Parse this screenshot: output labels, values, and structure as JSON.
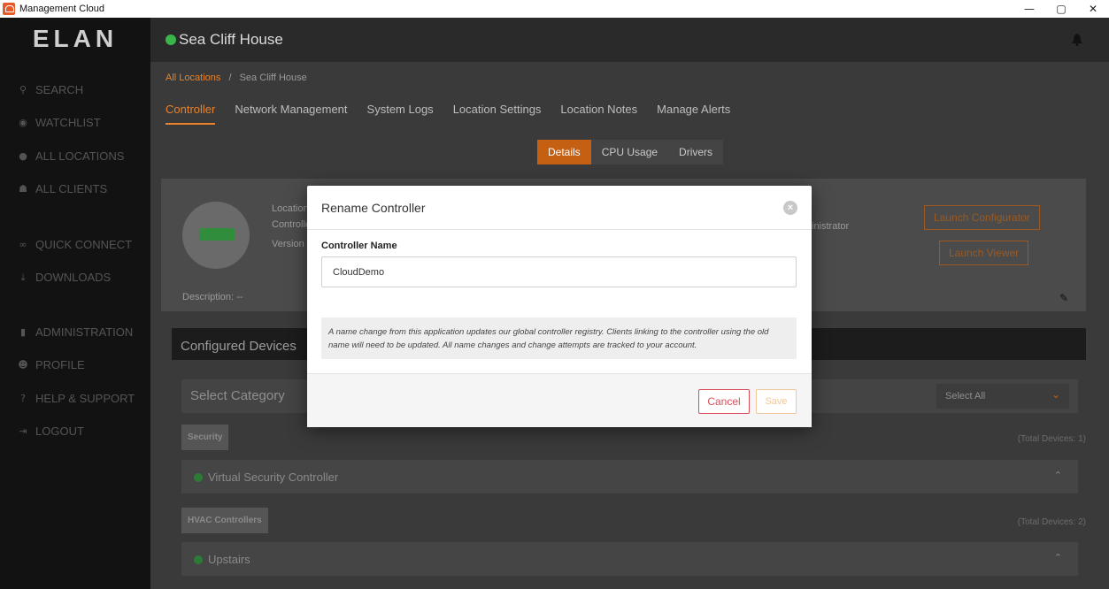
{
  "window": {
    "title": "Management Cloud",
    "controls": [
      "—",
      "▢",
      "✕"
    ]
  },
  "sidebar": {
    "logo": "ELAN",
    "items": [
      {
        "label": "SEARCH",
        "icon": "search-icon"
      },
      {
        "label": "WATCHLIST",
        "icon": "eye-icon"
      },
      {
        "label": "ALL LOCATIONS",
        "icon": "location-pin-icon"
      },
      {
        "label": "ALL CLIENTS",
        "icon": "people-icon"
      },
      {
        "label": "QUICK CONNECT",
        "icon": "link-icon"
      },
      {
        "label": "DOWNLOADS",
        "icon": "download-icon"
      },
      {
        "label": "ADMINISTRATION",
        "icon": "bar-chart-icon"
      },
      {
        "label": "PROFILE",
        "icon": "person-icon"
      },
      {
        "label": "HELP & SUPPORT",
        "icon": "help-icon"
      },
      {
        "label": "LOGOUT",
        "icon": "logout-icon"
      }
    ]
  },
  "header": {
    "site_name": "Sea Cliff House",
    "status_color": "#3ab54a"
  },
  "breadcrumb": {
    "root": "All Locations",
    "separator": "/",
    "current": "Sea Cliff House"
  },
  "tabs": [
    "Controller",
    "Network Management",
    "System Logs",
    "Location Settings",
    "Location Notes",
    "Manage Alerts"
  ],
  "subtabs": [
    "Details",
    "CPU Usage",
    "Drivers"
  ],
  "card": {
    "labels": [
      "Location",
      "Controller",
      "Version"
    ],
    "role_fragment": "inistrator",
    "description": "Description: --",
    "launch_configurator": "Launch Configurator",
    "launch_viewer": "Launch Viewer"
  },
  "devices": {
    "header": "Configured Devices",
    "select_category": "Select Category",
    "select_all": "Select All",
    "groups": [
      {
        "name": "Security",
        "total": "(Total Devices: 1)",
        "items": [
          "Virtual Security Controller"
        ]
      },
      {
        "name": "HVAC Controllers",
        "total": "(Total Devices: 2)",
        "items": [
          "Upstairs"
        ]
      }
    ]
  },
  "modal": {
    "title": "Rename Controller",
    "field_label": "Controller Name",
    "field_value": "CloudDemo",
    "notice": "A name change from this application updates our global controller registry. Clients linking to the controller using the old name will need to be updated. All name changes and change attempts are tracked to your account.",
    "cancel": "Cancel",
    "save": "Save"
  },
  "colors": {
    "accent": "#e8832a",
    "danger": "#d94e5a",
    "online": "#3ab54a"
  }
}
